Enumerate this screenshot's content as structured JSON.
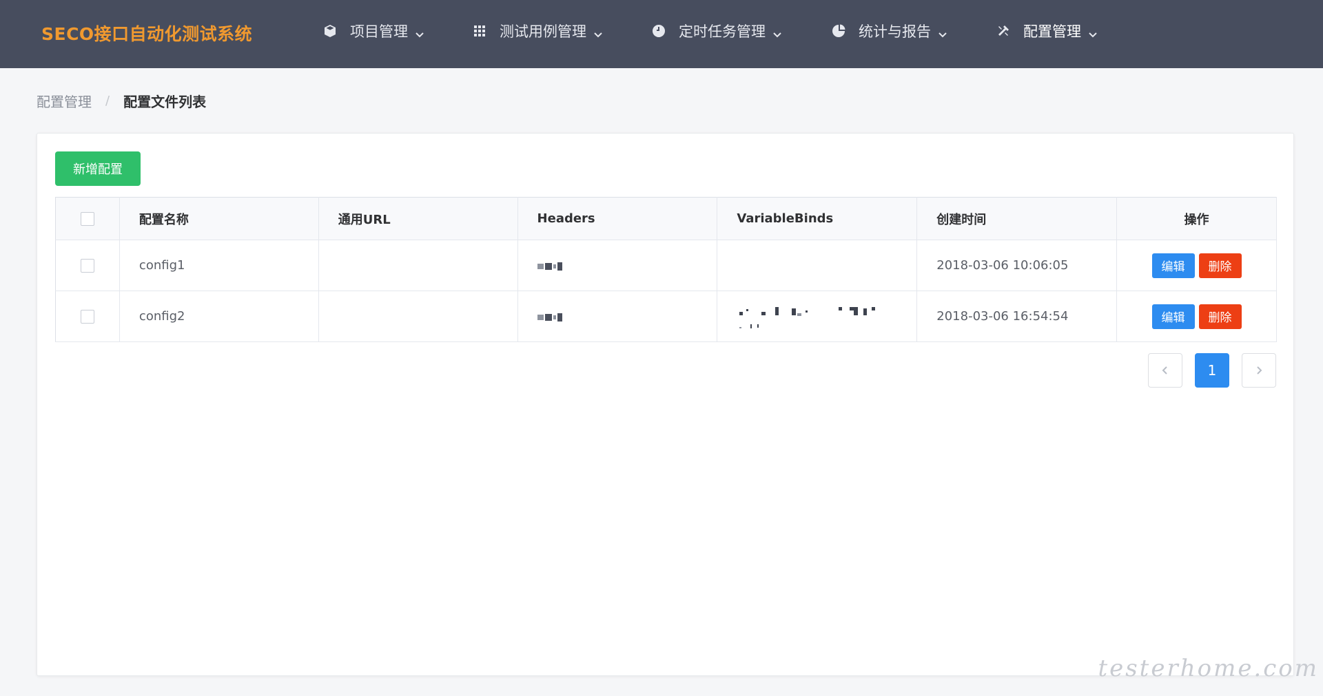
{
  "app": {
    "title": "SECO接口自动化测试系统"
  },
  "nav": [
    {
      "label": "项目管理",
      "icon": "cube-icon"
    },
    {
      "label": "测试用例管理",
      "icon": "grid-icon"
    },
    {
      "label": "定时任务管理",
      "icon": "clock-icon"
    },
    {
      "label": "统计与报告",
      "icon": "pie-chart-icon"
    },
    {
      "label": "配置管理",
      "icon": "tools-icon"
    }
  ],
  "breadcrumb": {
    "parent": "配置管理",
    "separator": "/",
    "current": "配置文件列表"
  },
  "toolbar": {
    "add_label": "新增配置"
  },
  "table": {
    "headers": [
      "配置名称",
      "通用URL",
      "Headers",
      "VariableBinds",
      "创建时间",
      "操作"
    ],
    "rows": [
      {
        "name": "config1",
        "url": "",
        "created": "2018-03-06 10:06:05"
      },
      {
        "name": "config2",
        "url": "",
        "created": "2018-03-06 16:54:54"
      }
    ],
    "actions": {
      "edit": "编辑",
      "delete": "删除"
    }
  },
  "pagination": {
    "current": "1"
  },
  "watermark": "testerhome.com",
  "colors": {
    "header_bg": "#474d5e",
    "brand": "#f0992f",
    "success": "#2fbf6a",
    "primary": "#2d8cf0",
    "danger": "#ed3f14"
  }
}
